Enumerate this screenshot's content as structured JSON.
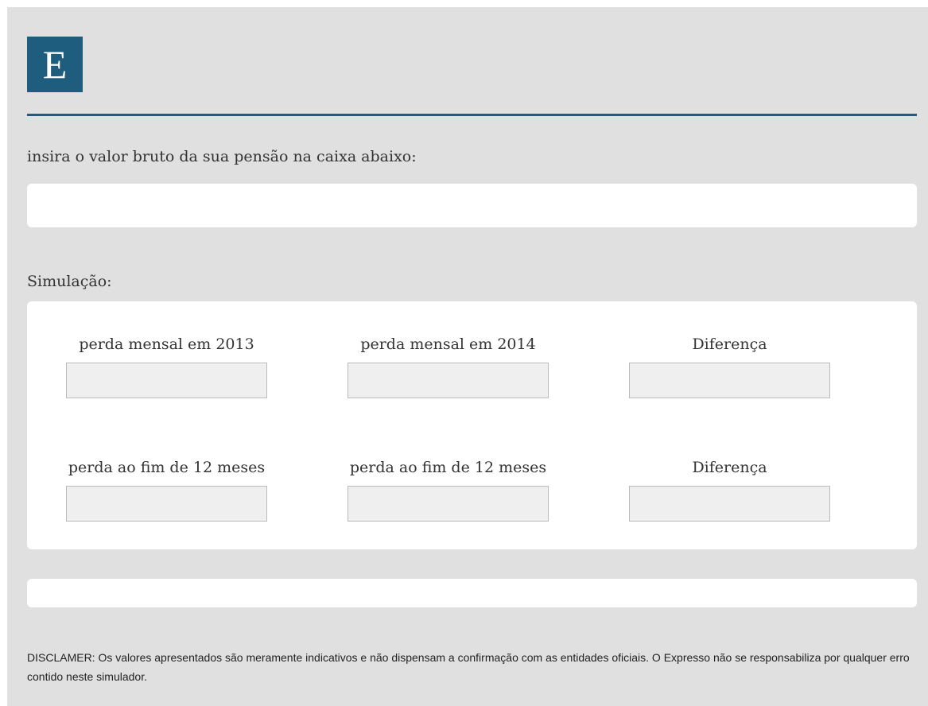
{
  "header": {
    "logo_letter": "E"
  },
  "form": {
    "prompt": "insira o valor bruto da sua pensão na caixa abaixo:",
    "pension_value": "",
    "pension_placeholder": ""
  },
  "simulation": {
    "label": "Simulação:",
    "row1": {
      "col1_label": "perda mensal em 2013",
      "col1_value": "",
      "col2_label": "perda mensal em 2014",
      "col2_value": "",
      "col3_label": "Diferença",
      "col3_value": ""
    },
    "row2": {
      "col1_label": "perda ao fim de 12 meses",
      "col1_value": "",
      "col2_label": "perda ao fim de 12 meses",
      "col2_value": "",
      "col3_label": "Diferença",
      "col3_value": ""
    }
  },
  "result": {
    "text": ""
  },
  "disclaimer": "DISCLAMER: Os valores apresentados são meramente indicativos e não dispensam a confirmação com as entidades oficiais. O Expresso não se responsabiliza por qualquer erro contido neste simulador.",
  "colors": {
    "brand": "#1e5d7e",
    "background": "#e0e0e0",
    "card": "#ffffff",
    "readonly_field": "#efefef"
  }
}
